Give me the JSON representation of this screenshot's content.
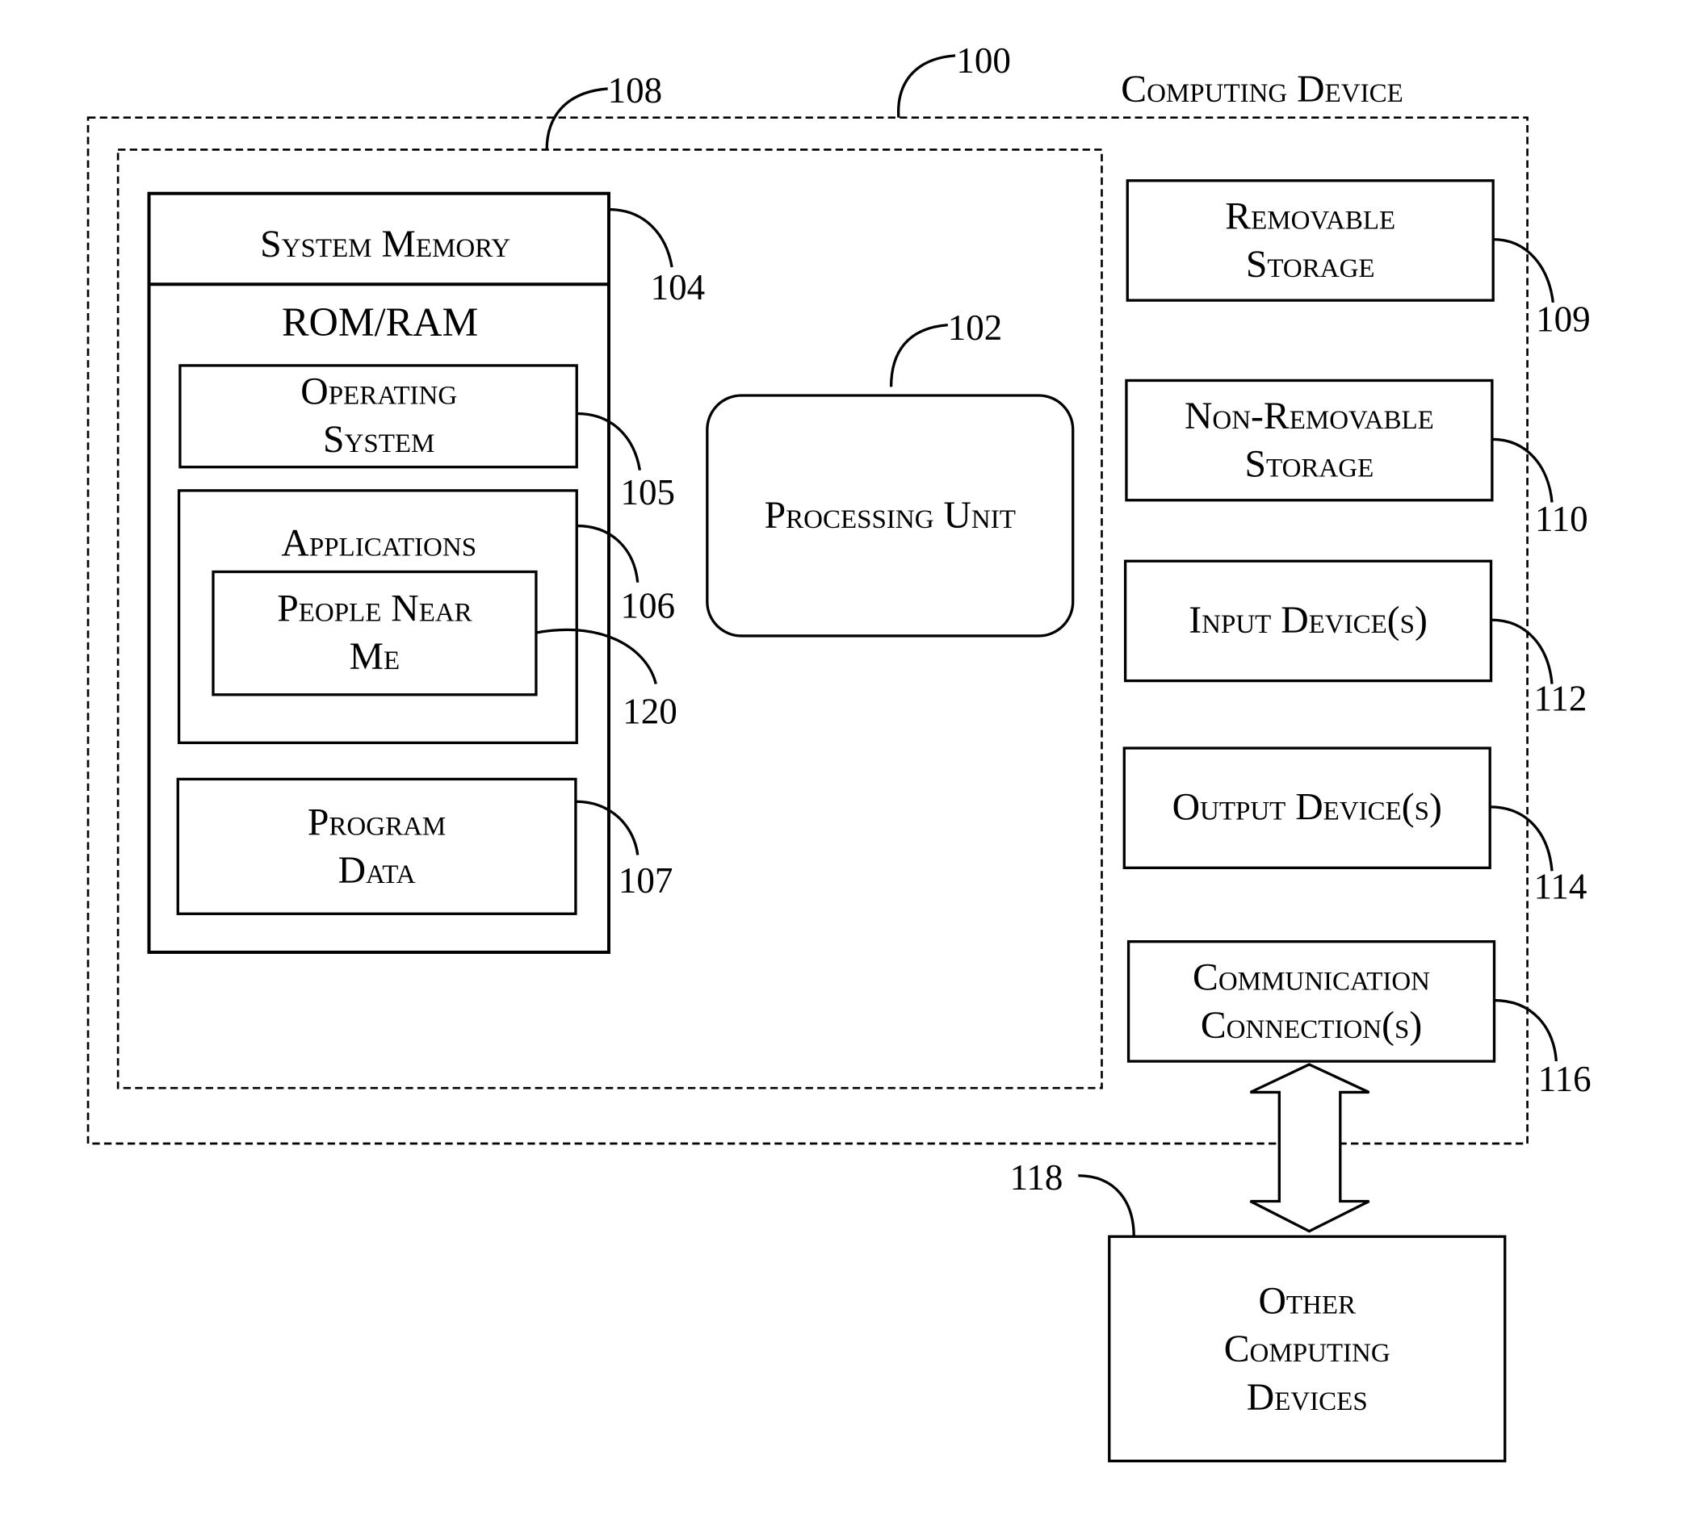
{
  "diagram": {
    "computing_device": {
      "label": "Computing Device",
      "ref": "100"
    },
    "basic_config": {
      "ref": "108"
    },
    "system_memory": {
      "label": "System Memory",
      "ref": "104",
      "sublabel": "ROM/RAM"
    },
    "operating_system": {
      "line1": "Operating",
      "line2": "System",
      "ref": "105"
    },
    "applications": {
      "label": "Applications",
      "ref": "106"
    },
    "people_near_me": {
      "line1": "People Near",
      "line2": "Me",
      "ref": "120"
    },
    "program_data": {
      "line1": "Program",
      "line2": "Data",
      "ref": "107"
    },
    "processing_unit": {
      "label": "Processing Unit",
      "ref": "102"
    },
    "removable_storage": {
      "line1": "Removable",
      "line2": "Storage",
      "ref": "109"
    },
    "non_removable_storage": {
      "line1": "Non-Removable",
      "line2": "Storage",
      "ref": "110"
    },
    "input_devices": {
      "label": "Input Device(s)",
      "ref": "112"
    },
    "output_devices": {
      "label": "Output Device(s)",
      "ref": "114"
    },
    "communication_connections": {
      "line1": "Communication",
      "line2": "Connection(s)",
      "ref": "116"
    },
    "other_computing_devices": {
      "line1": "Other",
      "line2": "Computing",
      "line3": "Devices",
      "ref": "118"
    }
  }
}
